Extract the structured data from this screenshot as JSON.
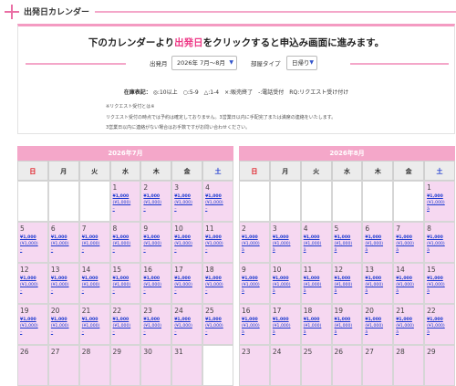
{
  "section": {
    "title": "出発日カレンダー"
  },
  "headline": {
    "pre": "下のカレンダーより",
    "highlight": "出発日",
    "post": "をクリックすると申込み画面に進みます。"
  },
  "filters": {
    "month_label": "出発月",
    "month_value": "2026年 7月～8月",
    "room_label": "部屋タイプ",
    "room_value": "日帰り"
  },
  "legend": {
    "label": "在庫表記：",
    "items": "◎:10以上　○:5-9　△:1-4　×:販売終了　-:電話受付　RQ:リクエスト受け付け"
  },
  "notes": [
    "※リクエスト受付とは※",
    "リクエスト受付の時点では予約は確定しておりません。3営業日以内に手配完了または満席の連絡をいたします。",
    "3営業日以内に連絡がない場合はお手数ですがお問い合わせください。"
  ],
  "weekdays": [
    "日",
    "月",
    "火",
    "水",
    "木",
    "金",
    "土"
  ],
  "calendars": [
    {
      "title": "2026年7月",
      "weeks": [
        [
          null,
          null,
          null,
          {
            "day": "1",
            "price": "¥1,000",
            "sub": "(¥1,000)",
            "status": "–"
          },
          {
            "day": "2",
            "price": "¥1,000",
            "sub": "(¥1,000)",
            "status": "–"
          },
          {
            "day": "3",
            "price": "¥1,000",
            "sub": "(¥1,000)",
            "status": "–"
          },
          {
            "day": "4",
            "price": "¥1,000",
            "sub": "(¥1,000)",
            "status": "–"
          }
        ],
        [
          {
            "day": "5",
            "price": "¥1,000",
            "sub": "(¥1,000)",
            "status": "–"
          },
          {
            "day": "6",
            "price": "¥1,000",
            "sub": "(¥1,000)",
            "status": "–"
          },
          {
            "day": "7",
            "price": "¥1,000",
            "sub": "(¥1,000)",
            "status": "–"
          },
          {
            "day": "8",
            "price": "¥1,000",
            "sub": "(¥1,000)",
            "status": "–"
          },
          {
            "day": "9",
            "price": "¥1,000",
            "sub": "(¥1,000)",
            "status": "–"
          },
          {
            "day": "10",
            "price": "¥1,000",
            "sub": "(¥1,000)",
            "status": "–"
          },
          {
            "day": "11",
            "price": "¥1,000",
            "sub": "(¥1,000)",
            "status": "–"
          }
        ],
        [
          {
            "day": "12",
            "price": "¥1,000",
            "sub": "(¥1,000)",
            "status": "–"
          },
          {
            "day": "13",
            "price": "¥1,000",
            "sub": "(¥1,000)",
            "status": "–"
          },
          {
            "day": "14",
            "price": "¥1,000",
            "sub": "(¥1,000)",
            "status": "–"
          },
          {
            "day": "15",
            "price": "¥1,000",
            "sub": "(¥1,000)",
            "status": "–"
          },
          {
            "day": "16",
            "price": "¥1,000",
            "sub": "(¥1,000)",
            "status": "–"
          },
          {
            "day": "17",
            "price": "¥1,000",
            "sub": "(¥1,000)",
            "status": "–"
          },
          {
            "day": "18",
            "price": "¥1,000",
            "sub": "(¥1,000)",
            "status": "–"
          }
        ],
        [
          {
            "day": "19",
            "price": "¥1,000",
            "sub": "(¥1,000)",
            "status": "–"
          },
          {
            "day": "20",
            "price": "¥1,000",
            "sub": "(¥1,000)",
            "status": "–"
          },
          {
            "day": "21",
            "price": "¥1,000",
            "sub": "(¥1,000)",
            "status": "–"
          },
          {
            "day": "22",
            "price": "¥1,000",
            "sub": "(¥1,000)",
            "status": "–"
          },
          {
            "day": "23",
            "price": "¥1,000",
            "sub": "(¥1,000)",
            "status": "–"
          },
          {
            "day": "24",
            "price": "¥1,000",
            "sub": "(¥1,000)",
            "status": "–"
          },
          {
            "day": "25",
            "price": "¥1,000",
            "sub": "(¥1,000)",
            "status": "–"
          }
        ],
        [
          {
            "day": "26"
          },
          {
            "day": "27"
          },
          {
            "day": "28"
          },
          {
            "day": "29"
          },
          {
            "day": "30"
          },
          {
            "day": "31"
          },
          null
        ]
      ]
    },
    {
      "title": "2026年8月",
      "weeks": [
        [
          null,
          null,
          null,
          null,
          null,
          null,
          {
            "day": "1",
            "price": "¥1,000",
            "sub": "(¥1,000)",
            "status": "ä"
          }
        ],
        [
          {
            "day": "2",
            "price": "¥1,000",
            "sub": "(¥1,000)",
            "status": "ä"
          },
          {
            "day": "3",
            "price": "¥1,000",
            "sub": "(¥1,000)",
            "status": "ä"
          },
          {
            "day": "4",
            "price": "¥1,000",
            "sub": "(¥1,000)",
            "status": "ä"
          },
          {
            "day": "5",
            "price": "¥1,000",
            "sub": "(¥1,000)",
            "status": "ä"
          },
          {
            "day": "6",
            "price": "¥1,000",
            "sub": "(¥1,000)",
            "status": "ä"
          },
          {
            "day": "7",
            "price": "¥1,000",
            "sub": "(¥1,000)",
            "status": "ä"
          },
          {
            "day": "8",
            "price": "¥1,000",
            "sub": "(¥1,000)",
            "status": "ä"
          }
        ],
        [
          {
            "day": "9",
            "price": "¥1,000",
            "sub": "(¥1,000)",
            "status": "ä"
          },
          {
            "day": "10",
            "price": "¥1,000",
            "sub": "(¥1,000)",
            "status": "ä"
          },
          {
            "day": "11",
            "price": "¥1,000",
            "sub": "(¥1,000)",
            "status": "ä"
          },
          {
            "day": "12",
            "price": "¥1,000",
            "sub": "(¥1,000)",
            "status": "ä"
          },
          {
            "day": "13",
            "price": "¥1,000",
            "sub": "(¥1,000)",
            "status": "ä"
          },
          {
            "day": "14",
            "price": "¥1,000",
            "sub": "(¥1,000)",
            "status": "ä"
          },
          {
            "day": "15",
            "price": "¥1,000",
            "sub": "(¥1,000)",
            "status": "ä"
          }
        ],
        [
          {
            "day": "16",
            "price": "¥1,000",
            "sub": "(¥1,000)",
            "status": "ä"
          },
          {
            "day": "17",
            "price": "¥1,000",
            "sub": "(¥1,000)",
            "status": "ä"
          },
          {
            "day": "18",
            "price": "¥1,000",
            "sub": "(¥1,000)",
            "status": "ä"
          },
          {
            "day": "19",
            "price": "¥1,000",
            "sub": "(¥1,000)",
            "status": "ä"
          },
          {
            "day": "20",
            "price": "¥1,000",
            "sub": "(¥1,000)",
            "status": "ä"
          },
          {
            "day": "21",
            "price": "¥1,000",
            "sub": "(¥1,000)",
            "status": "ä"
          },
          {
            "day": "22",
            "price": "¥1,000",
            "sub": "(¥1,000)",
            "status": "ä"
          }
        ],
        [
          {
            "day": "23"
          },
          {
            "day": "24"
          },
          {
            "day": "25"
          },
          {
            "day": "26"
          },
          {
            "day": "27"
          },
          {
            "day": "28"
          },
          {
            "day": "29"
          }
        ]
      ]
    }
  ]
}
